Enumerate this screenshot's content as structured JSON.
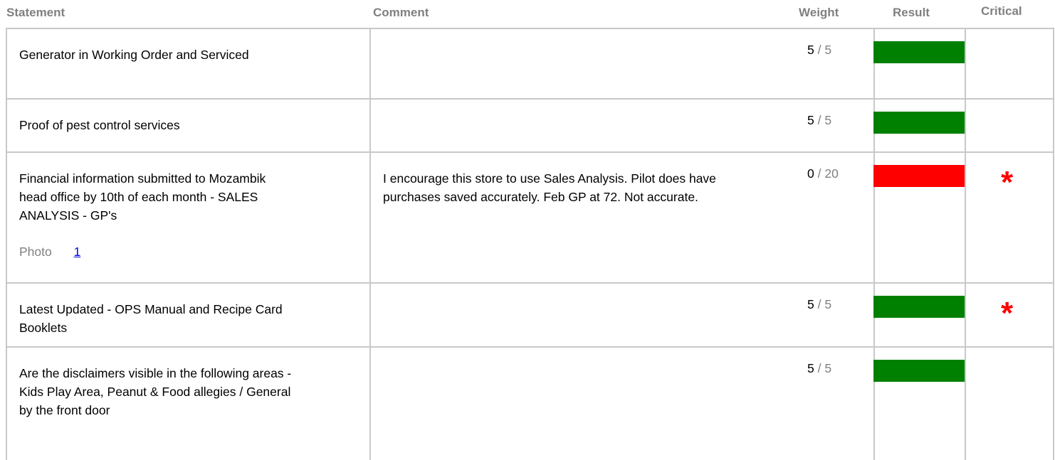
{
  "header": {
    "statement": "Statement",
    "comment": "Comment",
    "weight": "Weight",
    "result": "Result",
    "critical": "Critical"
  },
  "colors": {
    "pass": "#008000",
    "fail": "#ff0000",
    "border": "#c8c8c8",
    "muted": "#808080",
    "critical_mark": "#ff0000"
  },
  "rows": [
    {
      "statement": "Generator in Working Order and Serviced",
      "comment": "",
      "score": "5",
      "separator": "/",
      "max": "5",
      "result": "pass",
      "critical": false
    },
    {
      "statement": "Proof of pest control services",
      "comment": "",
      "score": "5",
      "separator": "/",
      "max": "5",
      "result": "pass",
      "critical": false
    },
    {
      "statement": "Financial information submitted to Mozambik head office by 10th of each month - SALES ANALYSIS - GP's",
      "comment": "I encourage this store to use Sales Analysis. Pilot does have purchases saved accurately. Feb GP at 72. Not accurate.",
      "score": "0",
      "separator": "/",
      "max": "20",
      "result": "fail",
      "critical": true,
      "critical_symbol": "*",
      "photo_label": "Photo",
      "photo_link": "1"
    },
    {
      "statement": "Latest Updated - OPS Manual and Recipe Card Booklets",
      "comment": "",
      "score": "5",
      "separator": "/",
      "max": "5",
      "result": "pass",
      "critical": true,
      "critical_symbol": "*"
    },
    {
      "statement": "Are the disclaimers visible in the following areas - Kids Play Area, Peanut & Food allegies / General by the front door",
      "comment": "",
      "score": "5",
      "separator": "/",
      "max": "5",
      "result": "pass",
      "critical": false
    }
  ]
}
